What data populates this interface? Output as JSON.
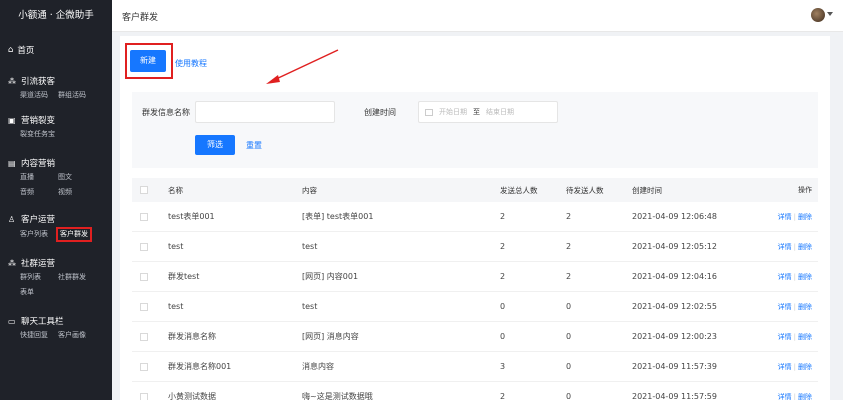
{
  "sidebar": {
    "brand": "小额通 · 企微助手",
    "home": "首页",
    "groups": [
      {
        "title": "引流获客",
        "icon": "people-network-icon",
        "items": [
          "渠道活码",
          "群组活码"
        ]
      },
      {
        "title": "营销裂变",
        "icon": "gift-icon",
        "items": [
          "裂变任务宝"
        ]
      },
      {
        "title": "内容营销",
        "icon": "content-icon",
        "items": [
          "直播",
          "图文",
          "音频",
          "视频"
        ]
      },
      {
        "title": "客户运营",
        "icon": "user-icon",
        "items": [
          "客户列表",
          "客户群发"
        ],
        "active": "客户群发"
      },
      {
        "title": "社群运营",
        "icon": "group-icon",
        "items": [
          "群列表",
          "社群群发",
          "表单"
        ]
      },
      {
        "title": "聊天工具栏",
        "icon": "chat-icon",
        "items": [
          "快捷回复",
          "客户画像"
        ]
      }
    ]
  },
  "topbar": {
    "title": "客户群发"
  },
  "toolbar": {
    "new_label": "新建",
    "tutorial_label": "使用教程"
  },
  "filter": {
    "name_label": "群发信息名称",
    "time_label": "创建时间",
    "start_placeholder": "开始日期",
    "to": "至",
    "end_placeholder": "结束日期",
    "filter_button": "筛选",
    "reset_link": "重置"
  },
  "table": {
    "headers": {
      "name": "名称",
      "content": "内容",
      "total": "发送总人数",
      "pending": "待发送人数",
      "time": "创建时间",
      "ops": "操作"
    },
    "detail_label": "详情",
    "delete_label": "删除",
    "rows": [
      {
        "name": "test表单001",
        "content": "[表单] test表单001",
        "total": "2",
        "pending": "2",
        "time": "2021-04-09 12:06:48"
      },
      {
        "name": "test",
        "content": "test",
        "total": "2",
        "pending": "2",
        "time": "2021-04-09 12:05:12"
      },
      {
        "name": "群发test",
        "content": "[网页] 内容001",
        "total": "2",
        "pending": "2",
        "time": "2021-04-09 12:04:16"
      },
      {
        "name": "test",
        "content": "test",
        "total": "0",
        "pending": "0",
        "time": "2021-04-09 12:02:55"
      },
      {
        "name": "群发消息名称",
        "content": "[网页] 消息内容",
        "total": "0",
        "pending": "0",
        "time": "2021-04-09 12:00:23"
      },
      {
        "name": "群发消息名称001",
        "content": "消息内容",
        "total": "3",
        "pending": "0",
        "time": "2021-04-09 11:57:39"
      },
      {
        "name": "小黄测试数据",
        "content": "嗨~这是测试数据哦",
        "total": "2",
        "pending": "0",
        "time": "2021-04-09 11:57:59"
      }
    ]
  },
  "colors": {
    "primary": "#1677ff",
    "sidebar": "#1f2229",
    "highlight": "#e02020"
  }
}
